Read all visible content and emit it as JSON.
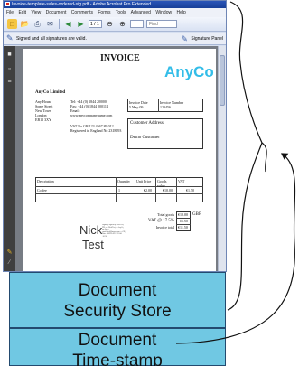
{
  "window": {
    "title": "Invoice-template-sales-ordered-sig.pdf - Adobe Acrobat Pro Extended",
    "menus": [
      "File",
      "Edit",
      "View",
      "Document",
      "Comments",
      "Forms",
      "Tools",
      "Advanced",
      "Window",
      "Help"
    ],
    "page_field": "1 / 1",
    "zoom_field": "",
    "search_placeholder": "Find"
  },
  "signature_bar": {
    "message": "Signed and all signatures are valid.",
    "panel_button": "Signature Panel"
  },
  "invoice": {
    "heading": "INVOICE",
    "logo": "AnyCo",
    "company_name": "AnyCo Limited",
    "address": [
      "Any House",
      "Some Street",
      "New Town",
      "London",
      "EB12 3XY"
    ],
    "contact": [
      "Tel: +44 (0) 1844 200000",
      "Fax: +44 (0) 1844 200114",
      "Email:",
      "www.anycompanyname.com"
    ],
    "vat": [
      "VAT No GB 123 4567 89 012",
      "Registered in England No 2318893"
    ],
    "invoice_date_label": "Invoice Date",
    "invoice_date": "5 May 09",
    "invoice_number_label": "Invoice Number",
    "invoice_number": "123456",
    "customer_address_label": "Customer Address",
    "customer_name": "Demo Customer",
    "columns": [
      "Description",
      "Quantity",
      "Unit Price",
      "Goods value",
      "VAT"
    ],
    "item": {
      "description": "Coffee",
      "quantity": "1",
      "unit_price": "€2.00",
      "goods_value": "€10.00",
      "vat": "€1.50"
    },
    "total_goods_label": "Total goods",
    "total_goods": "€10.00",
    "vat_rate_label": "VAT @ 17.5%",
    "vat_amount": "€1.50",
    "invoice_total_label": "Invoice total",
    "invoice_total": "€11.50",
    "currency": "GBP",
    "signature_line1": "Nick",
    "signature_line2": "Test",
    "signature_note": "Digitally signed by Nick Test, DN: cn=Nick Test, o=AnyCo, ou=Sales, email=nick@anyco.com, c=GB, Date: 2009.05.05 17:21:44 +01'00'"
  },
  "overlays": {
    "security_store_label": "Document\nSecurity Store",
    "timestamp_label": "Document\nTime-stamp"
  },
  "colors": {
    "panel_fill": "#70c8e3",
    "logo": "#33bde8",
    "titlebar": "#2a55b8"
  },
  "icons": [
    "pdf-icon",
    "create-icon",
    "open-icon",
    "print-icon",
    "email-icon",
    "prev-page-icon",
    "next-page-icon",
    "zoom-out-icon",
    "zoom-in-icon",
    "pen-icon",
    "lock-icon",
    "pages-icon",
    "attachments-icon",
    "signatures-icon"
  ]
}
